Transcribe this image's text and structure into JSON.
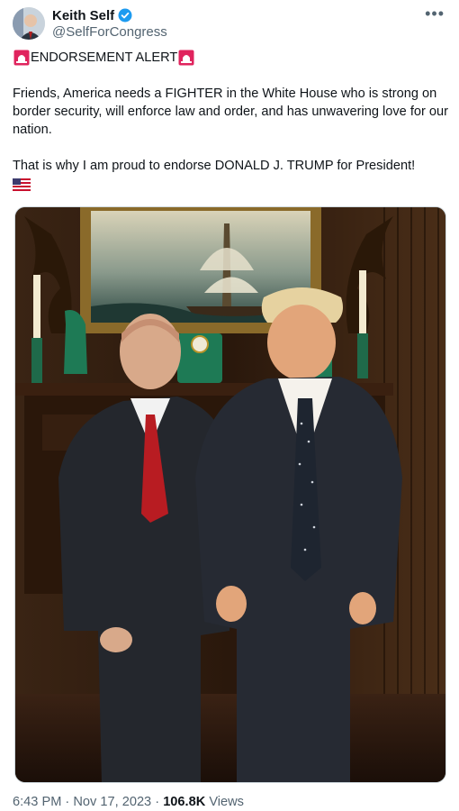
{
  "author": {
    "display_name": "Keith Self",
    "handle": "@SelfForCongress",
    "verified_icon": "verified-badge-icon",
    "avatar_icon": "avatar"
  },
  "menu": {
    "more_icon": "more-options-icon",
    "more_label": "•••"
  },
  "tweet": {
    "alert_label": "ENDORSEMENT ALERT",
    "alert_icons": [
      "siren-icon",
      "siren-icon"
    ],
    "paragraph_1": "Friends, America needs a FIGHTER in the White House who is strong on border security, will enforce law and order, and has unwavering love for our nation.",
    "paragraph_2": "That is why I am proud to endorse DONALD J. TRUMP for President!",
    "trailing_icon": "us-flag-icon"
  },
  "media": {
    "type": "photo"
  },
  "meta": {
    "time": "6:43 PM",
    "separator": "·",
    "date": "Nov 17, 2023",
    "views_count": "106.8K",
    "views_label": "Views"
  },
  "colors": {
    "text_primary": "#0f1419",
    "text_secondary": "#536471",
    "verified_blue": "#1d9bf0",
    "siren_red": "#e0245e"
  }
}
